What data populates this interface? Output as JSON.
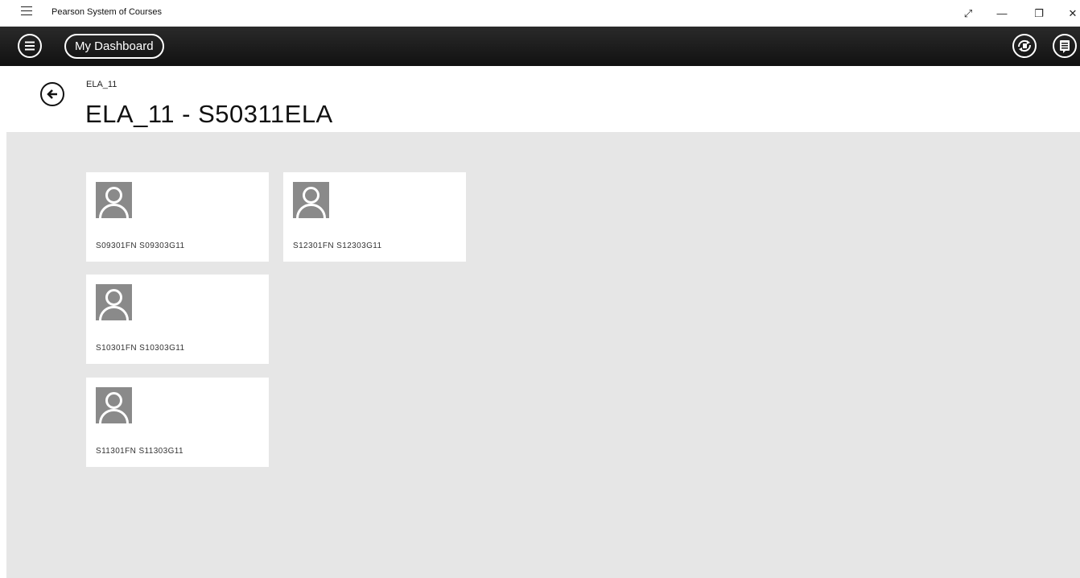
{
  "window": {
    "title": "Pearson System of Courses",
    "buttons": {
      "fullscreen": "⤢",
      "minimize": "—",
      "restore": "❐",
      "close": "✕"
    }
  },
  "appbar": {
    "dashboard_label": "My Dashboard"
  },
  "header": {
    "breadcrumb": "ELA_11",
    "title": "ELA_11 - S50311ELA"
  },
  "students": [
    {
      "name": "S09301FN S09303G11"
    },
    {
      "name": "S12301FN S12303G11"
    },
    {
      "name": "S10301FN S10303G11"
    },
    {
      "name": "S11301FN S11303G11"
    }
  ],
  "colors": {
    "appbar": "#1a1a1a",
    "content_bg": "#e6e6e6",
    "avatar": "#8a8a8a"
  }
}
